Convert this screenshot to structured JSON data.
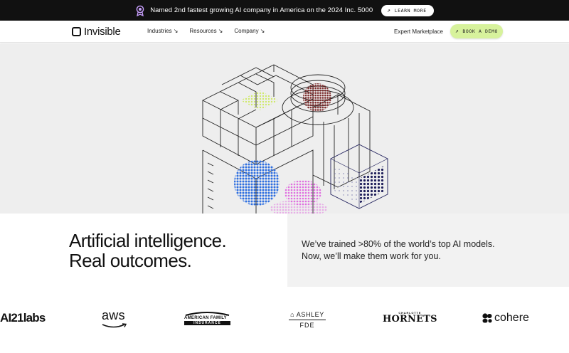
{
  "announcement": {
    "icon": "award-ribbon-icon",
    "accent": "#c9a0ff",
    "message": "Named 2nd fastest growing AI company in America on the 2024 Inc. 5000",
    "cta_arrow": "↗",
    "cta_label": "LEARN MORE"
  },
  "nav": {
    "logo_text": "Invisible",
    "menu": [
      {
        "label": "Industries",
        "chevron": "↘"
      },
      {
        "label": "Resources",
        "chevron": "↘"
      },
      {
        "label": "Company",
        "chevron": "↘"
      }
    ],
    "expert_link": "Expert Marketplace",
    "demo_arrow": "↗",
    "demo_label": "BOOK A DEMO",
    "demo_color": "#d7f29c"
  },
  "hero": {
    "illustration": "isometric-data-cubes",
    "colors": {
      "lime": "#cfe96a",
      "maroon": "#7a2a2a",
      "blue": "#2f6fe0",
      "pink": "#e070e0",
      "navy": "#1e1e5a"
    }
  },
  "band": {
    "headline_line1": "Artificial intelligence.",
    "headline_line2": "Real outcomes.",
    "sub_line1": "We’ve trained >80% of the world’s top AI models.",
    "sub_line2": "Now, we’ll make them work for you."
  },
  "logos": {
    "ai21": "AI21labs",
    "aws": "aws",
    "amfam_line1": "AMERICAN FAMILY",
    "amfam_line2": "INSURANCE",
    "ashley_line1": "ASHLEY",
    "ashley_line2": "FDE",
    "hornets_line1": "CHARLOTTE",
    "hornets_line2": "HORNETS",
    "cohere": "cohere"
  }
}
